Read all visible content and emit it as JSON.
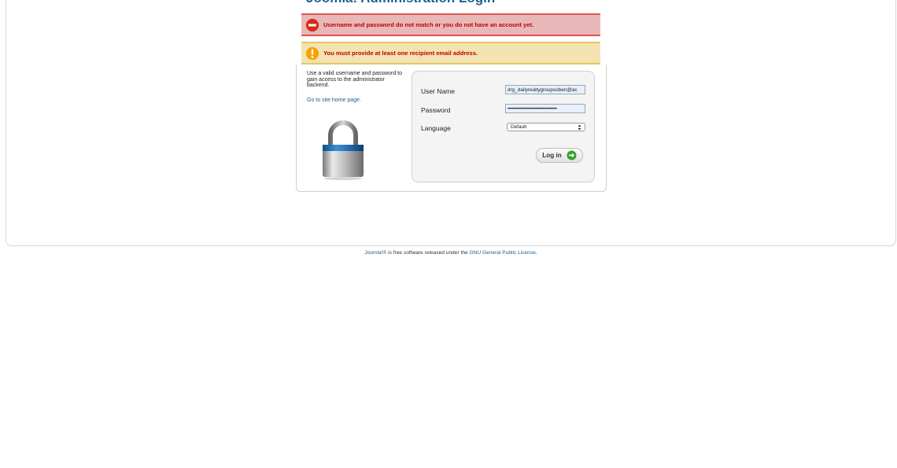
{
  "header": {
    "title": "Joomla! Administration Login"
  },
  "messages": {
    "error": "Username and password do not match or you do not have an account yet.",
    "notice": "You must provide at least one recipient email address."
  },
  "help": {
    "text": "Use a valid username and password to gain access to the administrator backend.",
    "home_link": "Go to site home page."
  },
  "form": {
    "username_label": "User Name",
    "username_value": "drg_dailyrealtygroupsoben@ac",
    "password_label": "Password",
    "password_value": "••••••••••••••••••••••••••••••••••",
    "language_label": "Language",
    "language_selected": "Default",
    "login_label": "Log in"
  },
  "footer": {
    "brand": "Joomla!®",
    "text": " is free software released under the ",
    "license_link": "GNU General Public License",
    "period": "."
  },
  "icons": {
    "error": "error-icon",
    "notice": "warning-icon",
    "lock": "lock-icon",
    "login": "arrow-right-icon",
    "select": "chevron-updown-icon"
  },
  "colors": {
    "title": "#1d5e93",
    "error_bg": "#e8b8b8",
    "notice_bg": "#f3e3b3",
    "message_text": "#c00000",
    "link": "#1d5e93"
  }
}
